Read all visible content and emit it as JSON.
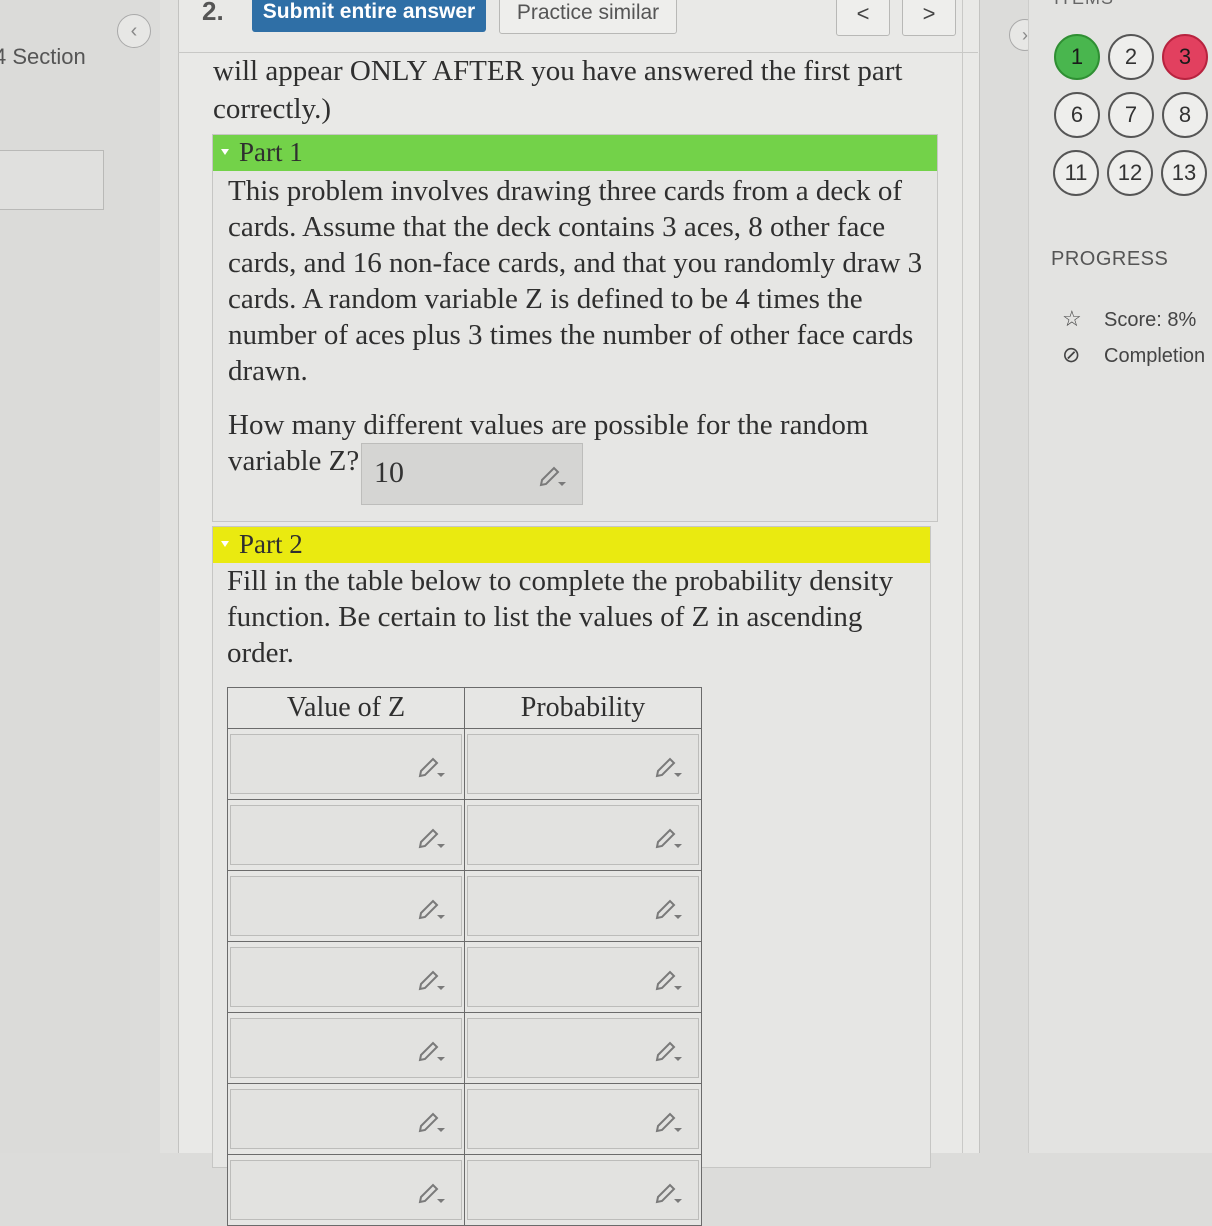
{
  "sidebar": {
    "section_label": "4 Section"
  },
  "toolbar": {
    "question_number": "2.",
    "submit_label": "Submit entire answer",
    "practice_label": "Practice similar",
    "prev_label": "<",
    "next_label": ">"
  },
  "question": {
    "intro": "will appear ONLY AFTER you have answered the first part correctly.)",
    "part1": {
      "title": "Part 1",
      "text": "This problem involves drawing three cards from a deck of cards. Assume that the deck contains 3 aces, 8 other face cards, and 16 non-face cards, and that you randomly draw 3 cards. A random variable Z is defined to be 4 times the number of aces plus 3 times the number of other face cards drawn.",
      "question": "How many different values are possible for the random variable Z?",
      "answer": "10"
    },
    "part2": {
      "title": "Part 2",
      "text": "Fill in the table below to complete the probability density function. Be certain to list the values of Z in ascending order.",
      "table": {
        "headers": [
          "Value of Z",
          "Probability"
        ],
        "row_count": 7
      }
    }
  },
  "items_panel": {
    "title": "ITEMS",
    "items": [
      {
        "label": "1",
        "status": "correct"
      },
      {
        "label": "2",
        "status": "unanswered"
      },
      {
        "label": "3",
        "status": "incorrect"
      },
      {
        "label": "6",
        "status": "unanswered"
      },
      {
        "label": "7",
        "status": "unanswered"
      },
      {
        "label": "8",
        "status": "unanswered"
      },
      {
        "label": "11",
        "status": "unanswered"
      },
      {
        "label": "12",
        "status": "unanswered"
      },
      {
        "label": "13",
        "status": "unanswered"
      }
    ]
  },
  "progress": {
    "title": "PROGRESS",
    "score": "Score: 8%",
    "completion": "Completion"
  },
  "colors": {
    "submit": "#2f6fa6",
    "part1_header": "#73d249",
    "part2_header": "#eaea10",
    "item_correct": "#49b64e",
    "item_incorrect": "#e2405f"
  }
}
